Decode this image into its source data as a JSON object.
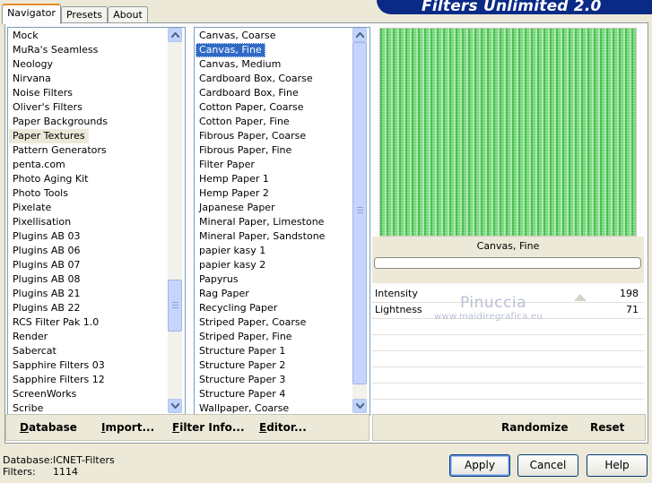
{
  "header": {
    "title": "Filters Unlimited 2.0"
  },
  "tabs": [
    {
      "label": "Navigator",
      "active": true
    },
    {
      "label": "Presets",
      "active": false
    },
    {
      "label": "About",
      "active": false
    }
  ],
  "categories": {
    "items": [
      "Mock",
      "MuRa's Seamless",
      "Neology",
      "Nirvana",
      "Noise Filters",
      "Oliver's Filters",
      "Paper Backgrounds",
      "Paper Textures",
      "Pattern Generators",
      "penta.com",
      "Photo Aging Kit",
      "Photo Tools",
      "Pixelate",
      "Pixellisation",
      "Plugins AB 03",
      "Plugins AB 06",
      "Plugins AB 07",
      "Plugins AB 08",
      "Plugins AB 21",
      "Plugins AB 22",
      "RCS Filter Pak 1.0",
      "Render",
      "Sabercat",
      "Sapphire Filters 03",
      "Sapphire Filters 12",
      "ScreenWorks",
      "Scribe"
    ],
    "selected": "Paper Textures"
  },
  "filters": {
    "items": [
      "Canvas, Coarse",
      "Canvas, Fine",
      "Canvas, Medium",
      "Cardboard Box, Coarse",
      "Cardboard Box, Fine",
      "Cotton Paper, Coarse",
      "Cotton Paper, Fine",
      "Fibrous Paper, Coarse",
      "Fibrous Paper, Fine",
      "Filter Paper",
      "Hemp Paper 1",
      "Hemp Paper 2",
      "Japanese Paper",
      "Mineral Paper, Limestone",
      "Mineral Paper, Sandstone",
      "papier kasy 1",
      "papier kasy 2",
      "Papyrus",
      "Rag Paper",
      "Recycling Paper",
      "Striped Paper, Coarse",
      "Striped Paper, Fine",
      "Structure Paper 1",
      "Structure Paper 2",
      "Structure Paper 3",
      "Structure Paper 4",
      "Wallpaper, Coarse"
    ],
    "selected": "Canvas, Fine"
  },
  "left_toolbar": {
    "database": "Database",
    "import": "Import...",
    "filter_info": "Filter Info...",
    "editor": "Editor..."
  },
  "preview": {
    "filter_name": "Canvas, Fine",
    "color": "#3dbf45"
  },
  "sliders": [
    {
      "label": "Intensity",
      "value": "198"
    },
    {
      "label": "Lightness",
      "value": "71"
    }
  ],
  "watermark": {
    "name": "Pinuccia",
    "site": "www.maidiregrafica.eu"
  },
  "right_toolbar": {
    "randomize": "Randomize",
    "reset": "Reset"
  },
  "status": {
    "database_label": "Database:",
    "database_value": "ICNET-Filters",
    "filters_label": "Filters:",
    "filters_value": "1114"
  },
  "dialog_buttons": {
    "apply": "Apply",
    "cancel": "Cancel",
    "help": "Help"
  }
}
